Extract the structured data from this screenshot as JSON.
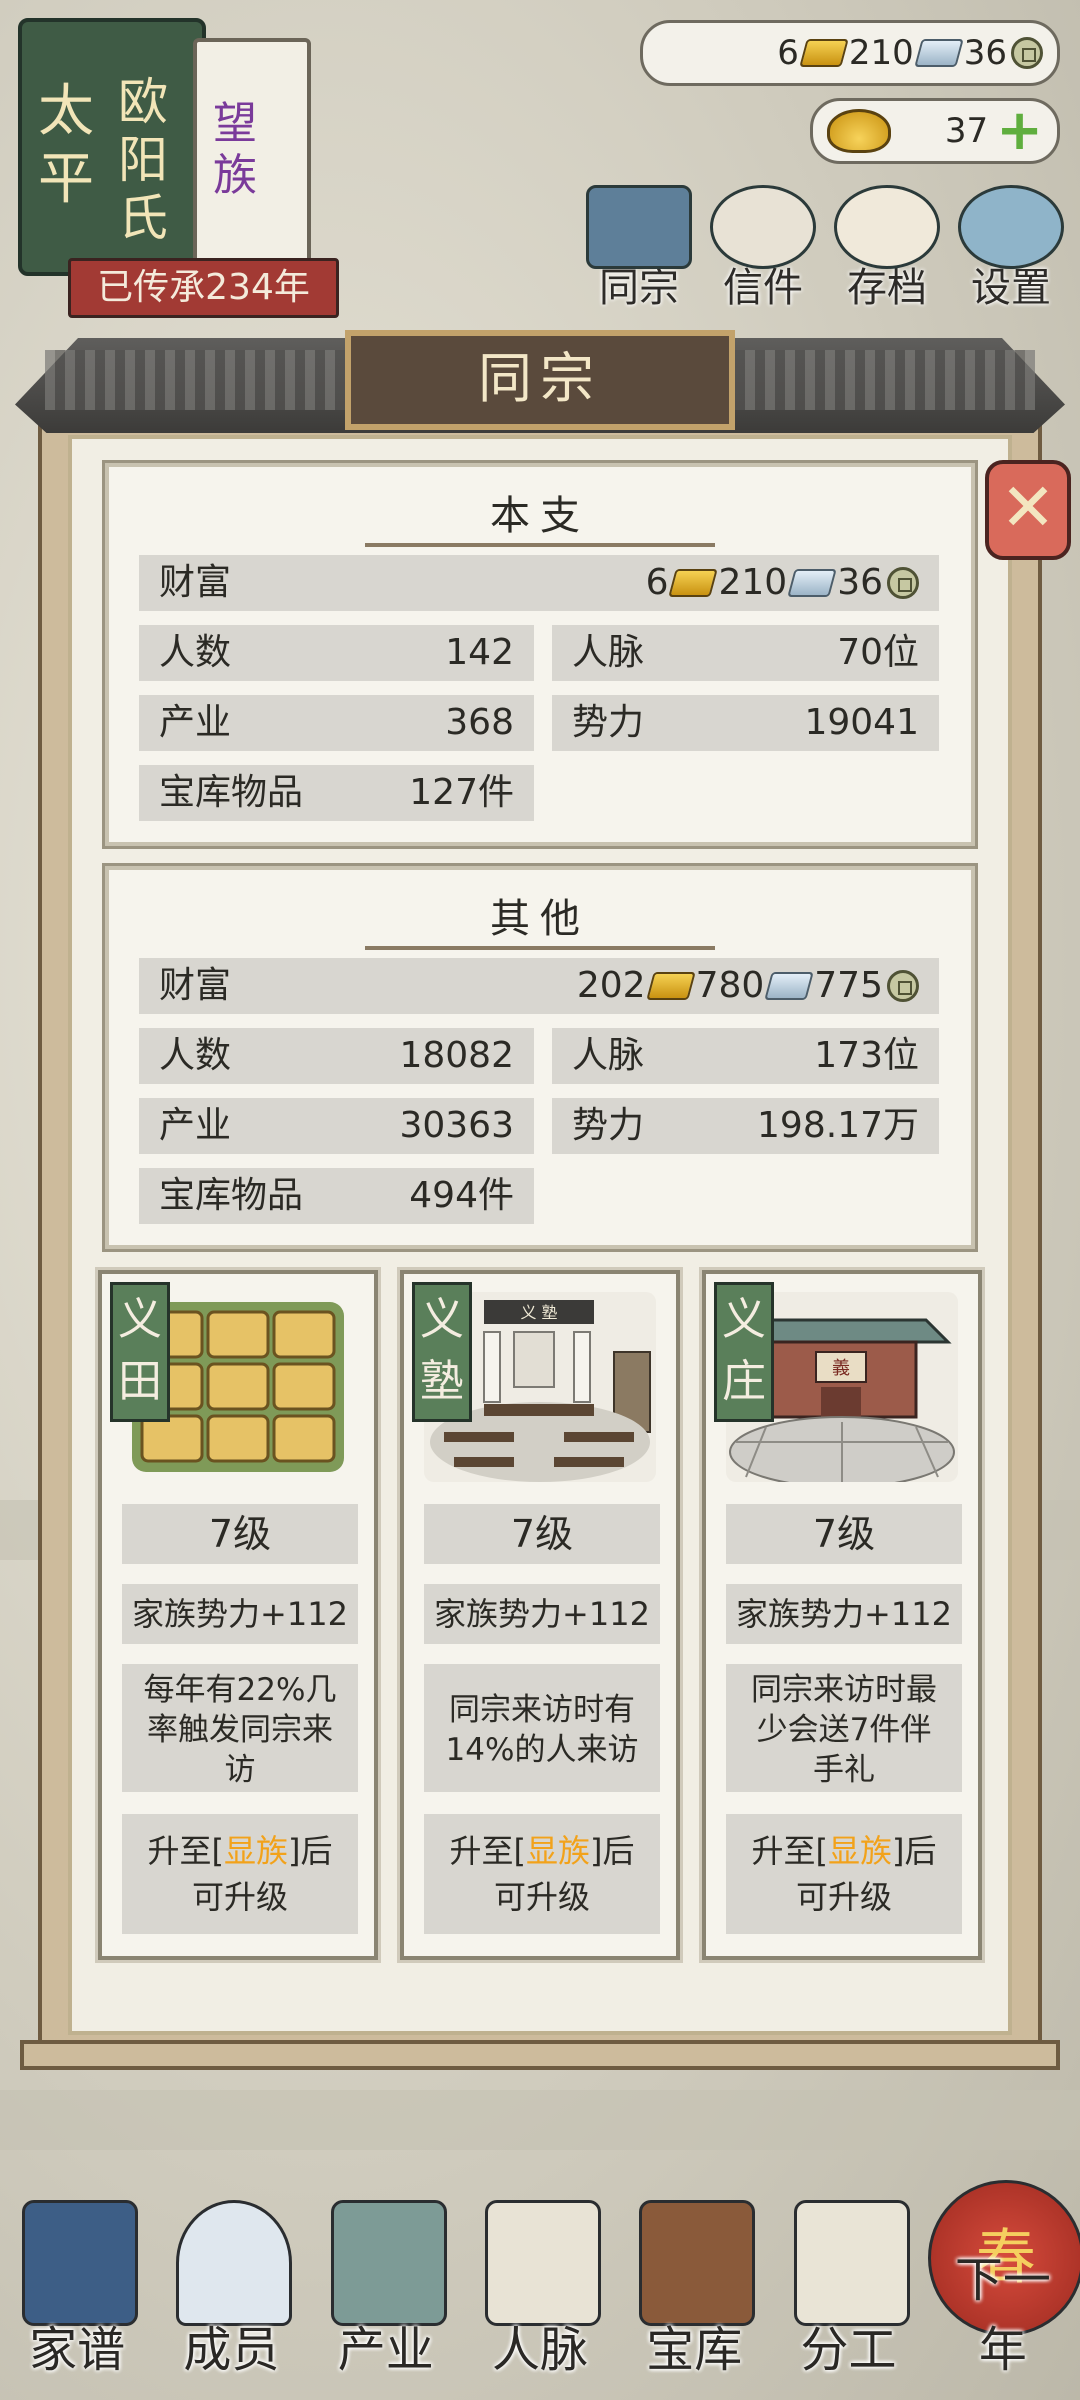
{
  "family": {
    "title_chars": "太平",
    "surname": "欧阳氏",
    "rank": "望族",
    "generations": "已传承234年"
  },
  "currency": {
    "gold": "6",
    "silver": "210",
    "copper": "36",
    "ingots": "37"
  },
  "top_menu": [
    {
      "label": "同宗",
      "icon": "book-icon"
    },
    {
      "label": "信件",
      "icon": "letter-icon"
    },
    {
      "label": "存档",
      "icon": "scroll-icon"
    },
    {
      "label": "设置",
      "icon": "gear-icon"
    }
  ],
  "dialog": {
    "title": "同宗",
    "close": "✕",
    "main_branch": {
      "heading": "本支",
      "wealth_label": "财富",
      "wealth": {
        "gold": "6",
        "silver": "210",
        "copper": "36"
      },
      "people_label": "人数",
      "people": "142",
      "network_label": "人脉",
      "network": "70位",
      "property_label": "产业",
      "property": "368",
      "power_label": "势力",
      "power": "19041",
      "treasury_label": "宝库物品",
      "treasury": "127件"
    },
    "others": {
      "heading": "其他",
      "wealth_label": "财富",
      "wealth": {
        "gold": "202",
        "silver": "780",
        "copper": "775"
      },
      "people_label": "人数",
      "people": "18082",
      "network_label": "人脉",
      "network": "173位",
      "property_label": "产业",
      "property": "30363",
      "power_label": "势力",
      "power": "198.17万",
      "treasury_label": "宝库物品",
      "treasury": "494件"
    },
    "features": [
      {
        "tag1": "义",
        "tag2": "田",
        "level": "7级",
        "bonus": "家族势力+112",
        "desc": [
          "每年有22%几",
          "率触发同宗来",
          "访"
        ],
        "up_pre": "升至[",
        "up_hl": "显族",
        "up_post": "]后",
        "up_line2": "可升级"
      },
      {
        "tag1": "义",
        "tag2": "塾",
        "level": "7级",
        "bonus": "家族势力+112",
        "desc": [
          "同宗来访时有",
          "14%的人来访"
        ],
        "up_pre": "升至[",
        "up_hl": "显族",
        "up_post": "]后",
        "up_line2": "可升级"
      },
      {
        "tag1": "义",
        "tag2": "庄",
        "level": "7级",
        "bonus": "家族势力+112",
        "desc": [
          "同宗来访时最",
          "少会送7件伴",
          "手礼"
        ],
        "up_pre": "升至[",
        "up_hl": "显族",
        "up_post": "]后",
        "up_line2": "可升级"
      }
    ],
    "school_sign": "义 塾",
    "hall_sign": "義"
  },
  "bottom_nav": [
    {
      "label": "家谱"
    },
    {
      "label": "成员"
    },
    {
      "label": "产业"
    },
    {
      "label": "人脉"
    },
    {
      "label": "宝库"
    },
    {
      "label": "分工"
    },
    {
      "label": "下一年",
      "badge": "春"
    }
  ],
  "colors": {
    "accent_gold": "#f2a21a",
    "panel_green": "#5a7f5a",
    "close_red": "#d96a5b"
  }
}
